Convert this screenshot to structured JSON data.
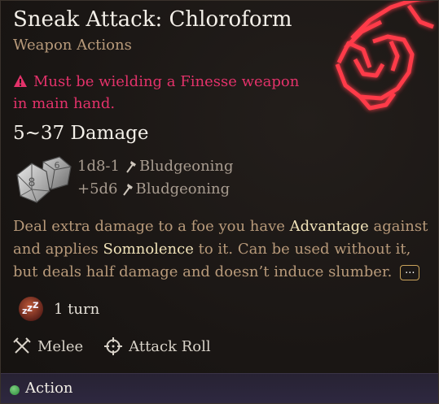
{
  "spell": {
    "title": "Sneak Attack: Chloroform",
    "category": "Weapon Actions",
    "requirement": "Must be wielding a Finesse weapon in main hand.",
    "damage_range": "5~37 Damage",
    "damage_rows": [
      {
        "dice": "1d8-1",
        "type": "Bludgeoning"
      },
      {
        "dice": "+5d6",
        "type": "Bludgeoning"
      }
    ],
    "description": {
      "p1": "Deal extra damage to a foe you have ",
      "kw1": "Advantage",
      "p2": " against and applies ",
      "kw2": "Somnolence",
      "p3": " to it. Can be used without it, but deals half damage and doesn’t induce slumber.",
      "more_label": "..."
    },
    "duration": "1 turn",
    "properties": [
      {
        "label": "Melee",
        "icon": "crossed-swords-icon"
      },
      {
        "label": "Attack Roll",
        "icon": "crosshair-icon"
      }
    ],
    "action_cost": "Action"
  },
  "dice_faces": {
    "d8": "8",
    "d6": "6"
  },
  "colors": {
    "warning": "#e3326a",
    "keyword": "#f0e2b8",
    "body_text": "#b89a7a",
    "glow": "#ff2d3c",
    "action_dot": "#3fa24c"
  }
}
